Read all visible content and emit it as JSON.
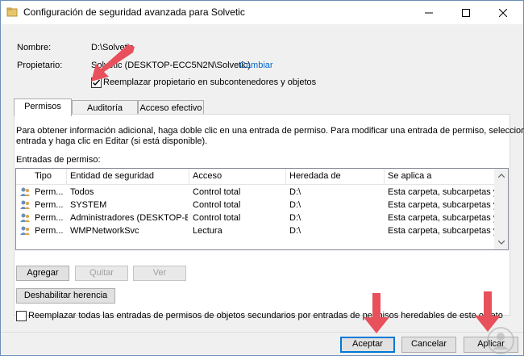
{
  "window": {
    "title": "Configuración de seguridad avanzada para Solvetic",
    "minimize": "minimize",
    "maximize": "maximize",
    "close": "close"
  },
  "info": {
    "name_label": "Nombre:",
    "name_value": "D:\\Solvetic",
    "owner_label": "Propietario:",
    "owner_value": "Solvetic (DESKTOP-ECC5N2N\\Solvetic)",
    "change_link": "Cambiar",
    "replace_owner_checkbox": "Reemplazar propietario en subcontenedores y objetos",
    "replace_owner_checked": true
  },
  "tabs": [
    {
      "label": "Permisos",
      "active": true
    },
    {
      "label": "Auditoría",
      "active": false
    },
    {
      "label": "Acceso efectivo",
      "active": false
    }
  ],
  "instructions": "Para obtener información adicional, haga doble clic en una entrada de permiso. Para modificar una entrada de permiso, seleccione la",
  "instructions2": "entrada y haga clic en Editar (si está disponible).",
  "entries_label": "Entradas de permiso:",
  "table": {
    "columns": [
      "Tipo",
      "Entidad de seguridad",
      "Acceso",
      "Heredada de",
      "Se aplica a"
    ],
    "rows": [
      {
        "type": "Perm...",
        "principal": "Todos",
        "access": "Control total",
        "inherited": "D:\\",
        "applies": "Esta carpeta, subcarpetas y arc..."
      },
      {
        "type": "Perm...",
        "principal": "SYSTEM",
        "access": "Control total",
        "inherited": "D:\\",
        "applies": "Esta carpeta, subcarpetas y arc..."
      },
      {
        "type": "Perm...",
        "principal": "Administradores (DESKTOP-E...",
        "access": "Control total",
        "inherited": "D:\\",
        "applies": "Esta carpeta, subcarpetas y arc..."
      },
      {
        "type": "Perm...",
        "principal": "WMPNetworkSvc",
        "access": "Lectura",
        "inherited": "D:\\",
        "applies": "Esta carpeta, subcarpetas y arc..."
      }
    ]
  },
  "buttons": {
    "add": "Agregar",
    "remove": "Quitar",
    "view": "Ver",
    "disable_inheritance": "Deshabilitar herencia",
    "ok": "Aceptar",
    "cancel": "Cancelar",
    "apply": "Aplicar"
  },
  "replace_all_checkbox": "Reemplazar todas las entradas de permisos de objetos secundarios por entradas de permisos heredables de este objeto",
  "replace_all_checked": false,
  "colors": {
    "link": "#0066cc",
    "annotation_arrow": "#e8505b",
    "primary_border": "#0078d7"
  }
}
